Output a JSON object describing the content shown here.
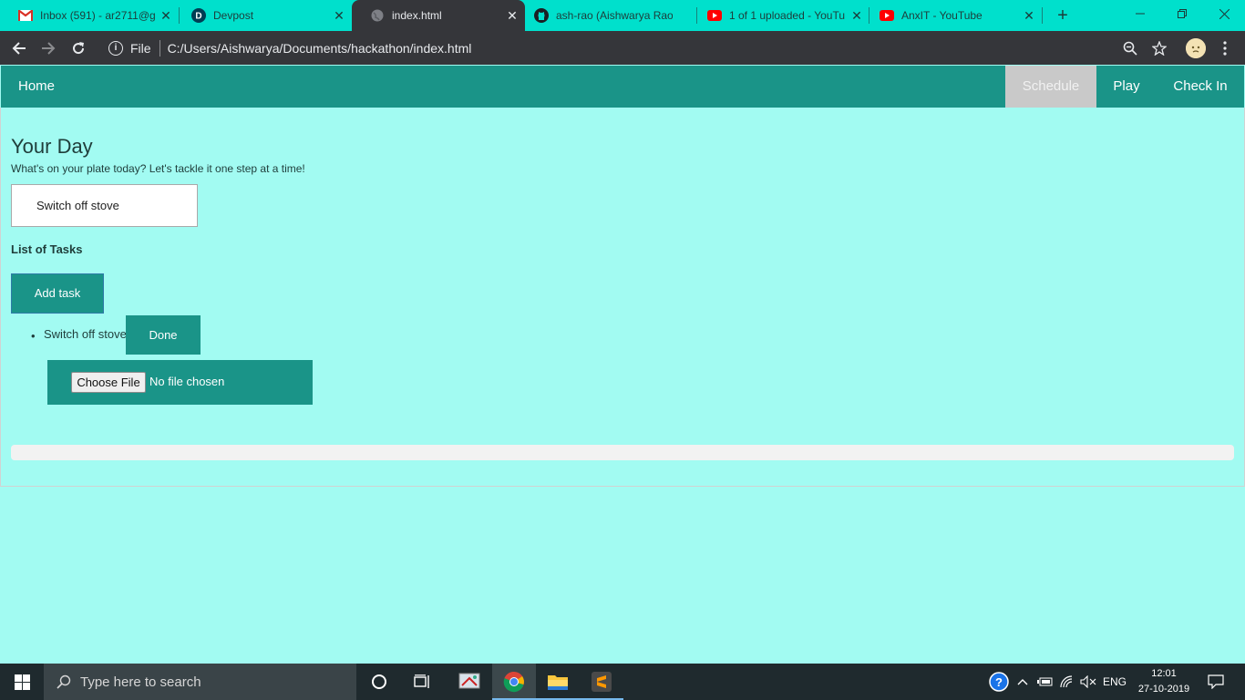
{
  "browser": {
    "tabs": [
      {
        "title": "Inbox (591) - ar2711@g",
        "icon": "gmail-icon",
        "active": false
      },
      {
        "title": "Devpost",
        "icon": "devpost-icon",
        "active": false
      },
      {
        "title": "index.html",
        "icon": "globe-icon",
        "active": true
      },
      {
        "title": "ash-rao (Aishwarya Rao",
        "icon": "github-icon",
        "active": false
      },
      {
        "title": "1 of 1 uploaded - YouTu",
        "icon": "youtube-icon",
        "active": false
      },
      {
        "title": "AnxIT - YouTube",
        "icon": "youtube-icon",
        "active": false
      }
    ],
    "address": {
      "scheme_label": "File",
      "url": "C:/Users/Aishwarya/Documents/hackathon/index.html"
    }
  },
  "nav": {
    "home": "Home",
    "schedule": "Schedule",
    "play": "Play",
    "checkin": "Check In",
    "active": "Schedule"
  },
  "main": {
    "heading": "Your Day",
    "tagline": "What's on your plate today? Let's tackle it one step at a time!",
    "task_input_value": "Switch off stove",
    "list_title": "List of Tasks",
    "add_task_label": "Add task",
    "tasks": [
      {
        "text": "Switch off stove",
        "done_label": "Done"
      }
    ],
    "file_input": {
      "button_label": "Choose File",
      "status": "No file chosen"
    },
    "progress_fraction": 0
  },
  "taskbar": {
    "search_placeholder": "Type here to search",
    "language": "ENG",
    "time": "12:01",
    "date": "27-10-2019"
  },
  "colors": {
    "tabstrip": "#00e0cc",
    "navbar": "#1a9488",
    "page_background": "#a2fbf2",
    "nav_active": "#c9c9c9"
  }
}
